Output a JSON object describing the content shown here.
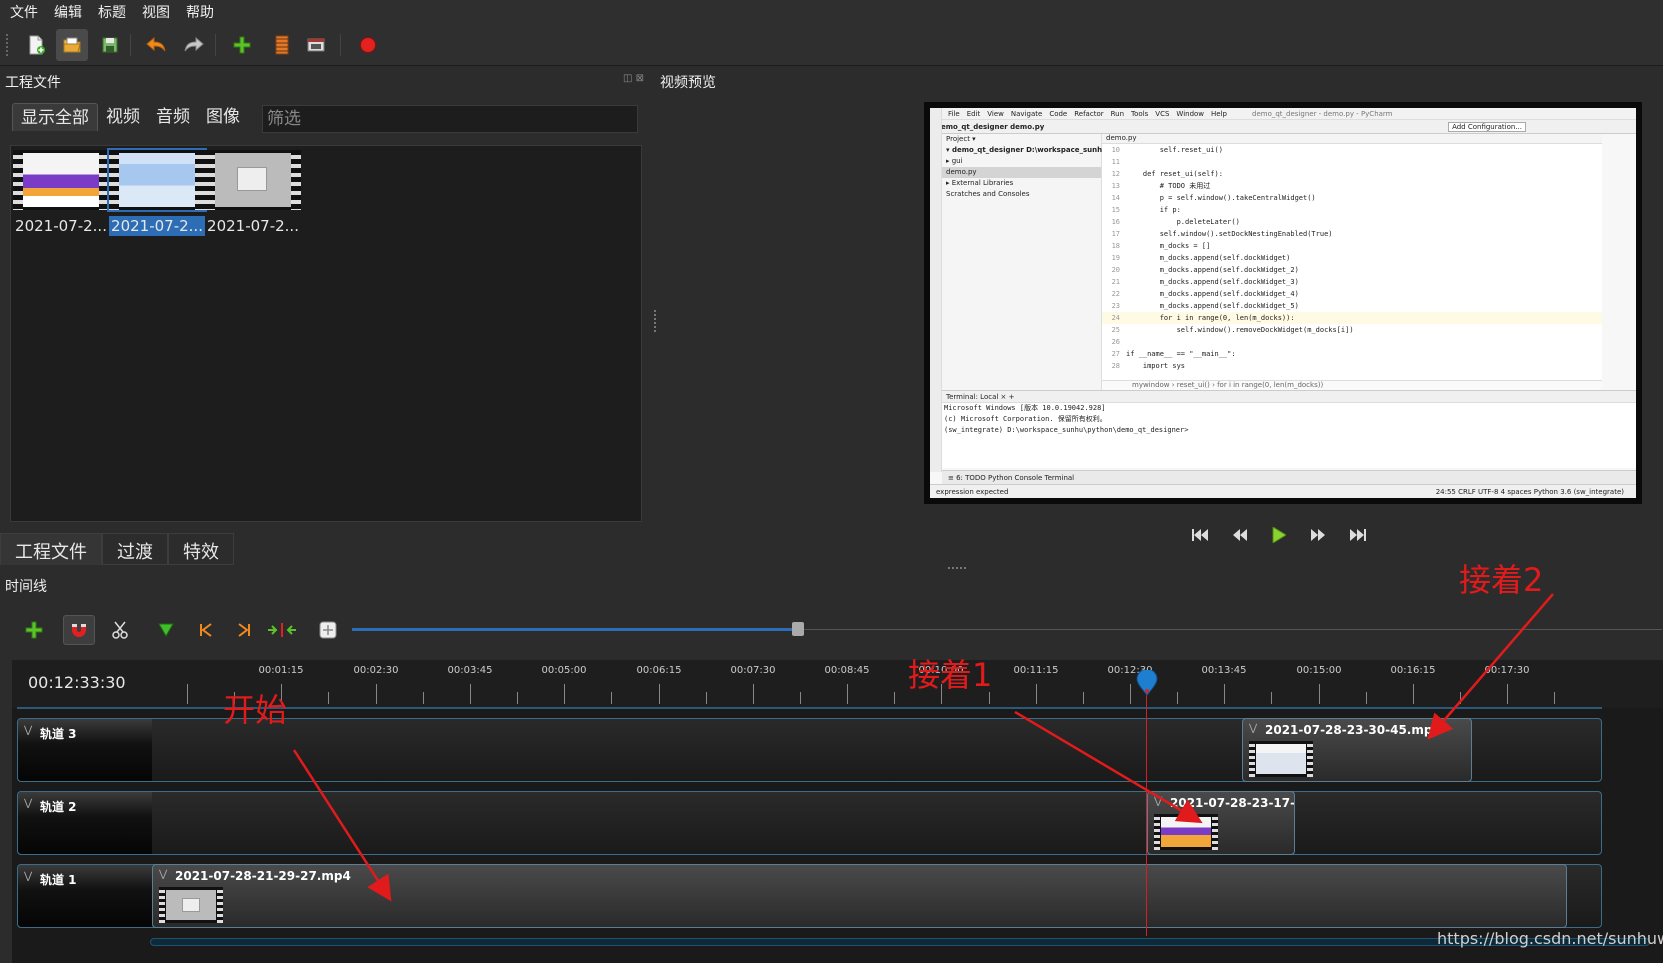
{
  "menubar": {
    "items": [
      "文件",
      "编辑",
      "标题",
      "视图",
      "帮助"
    ]
  },
  "toolbar": {
    "icons": [
      "new-project-icon",
      "open-project-icon",
      "save-project-icon",
      "undo-icon",
      "redo-icon",
      "import-files-icon",
      "profile-icon",
      "fullscreen-icon",
      "record-icon"
    ]
  },
  "project_files": {
    "title": "工程文件",
    "filters": [
      "显示全部",
      "视频",
      "音频",
      "图像"
    ],
    "filter_placeholder": "筛选",
    "files": [
      {
        "label": "2021-07-2..."
      },
      {
        "label": "2021-07-2..."
      },
      {
        "label": "2021-07-2..."
      }
    ],
    "bottom_tabs": [
      "工程文件",
      "过渡",
      "特效"
    ]
  },
  "preview": {
    "title": "视频预览",
    "ide": {
      "menu": [
        "File",
        "Edit",
        "View",
        "Navigate",
        "Code",
        "Refactor",
        "Run",
        "Tools",
        "VCS",
        "Window",
        "Help"
      ],
      "window_title": "demo_qt_designer - demo.py - PyCharm",
      "breadcrumb": "demo_qt_designer  demo.py",
      "run_config": "Add Configuration...",
      "project_tree": [
        "Project ▾",
        "▾ demo_qt_designer  D:\\workspace_sunhu",
        "  ▸ gui",
        "    demo.py",
        "▸ External Libraries",
        "  Scratches and Consoles"
      ],
      "code_tab": "demo.py",
      "code_lines": [
        {
          "n": "10",
          "t": "        self.reset_ui()"
        },
        {
          "n": "11",
          "t": ""
        },
        {
          "n": "12",
          "t": "    def reset_ui(self):"
        },
        {
          "n": "13",
          "t": "        # TODO 未用过"
        },
        {
          "n": "14",
          "t": "        p = self.window().takeCentralWidget()"
        },
        {
          "n": "15",
          "t": "        if p:"
        },
        {
          "n": "16",
          "t": "            p.deleteLater()"
        },
        {
          "n": "17",
          "t": "        self.window().setDockNestingEnabled(True)"
        },
        {
          "n": "18",
          "t": "        m_docks = []"
        },
        {
          "n": "19",
          "t": "        m_docks.append(self.dockWidget)"
        },
        {
          "n": "20",
          "t": "        m_docks.append(self.dockWidget_2)"
        },
        {
          "n": "21",
          "t": "        m_docks.append(self.dockWidget_3)"
        },
        {
          "n": "22",
          "t": "        m_docks.append(self.dockWidget_4)"
        },
        {
          "n": "23",
          "t": "        m_docks.append(self.dockWidget_5)"
        },
        {
          "n": "24",
          "t": "        for i in range(0, len(m_docks)):"
        },
        {
          "n": "25",
          "t": "            self.window().removeDockWidget(m_docks[i])"
        },
        {
          "n": "26",
          "t": ""
        },
        {
          "n": "27",
          "t": "if __name__ == \"__main__\":"
        },
        {
          "n": "28",
          "t": "    import sys"
        }
      ],
      "code_breadcrumb": "mywindow  ›  reset_ui()  ›  for i in range(0, len(m_docks))",
      "terminal_header": "Terminal:   Local  ×   +",
      "terminal_lines": [
        "Microsoft Windows [版本 10.0.19042.928]",
        "(c) Microsoft Corporation. 保留所有权利。",
        "(sw_integrate) D:\\workspace_sunhu\\python\\demo_qt_designer>"
      ],
      "bottom_tabs": "≡ 6: TODO    Python Console    Terminal",
      "status_left": "expression expected",
      "status_right": "24:55   CRLF   UTF-8   4 spaces   Python 3.6 (sw_integrate)"
    },
    "controls": [
      "jump-start-icon",
      "rewind-icon",
      "play-icon",
      "fast-forward-icon",
      "jump-end-icon"
    ]
  },
  "timeline": {
    "title": "时间线",
    "current_time": "00:12:33:30",
    "ticks": [
      "00:01:15",
      "00:02:30",
      "00:03:45",
      "00:05:00",
      "00:06:15",
      "00:07:30",
      "00:08:45",
      "00:10:00",
      "00:11:15",
      "00:12:30",
      "00:13:45",
      "00:15:00",
      "00:16:15",
      "00:17:30"
    ],
    "zoom_fraction": 0.34,
    "tracks": [
      {
        "name": "轨道 3",
        "clips": [
          {
            "name": "2021-07-28-23-30-45.mp4"
          }
        ]
      },
      {
        "name": "轨道 2",
        "clips": [
          {
            "name": "2021-07-28-23-17-..."
          }
        ]
      },
      {
        "name": "轨道 1",
        "clips": [
          {
            "name": "2021-07-28-21-29-27.mp4"
          }
        ]
      }
    ]
  },
  "annotations": {
    "start": "开始",
    "next1": "接着1",
    "next2": "接着2"
  },
  "watermark": "https://blog.csdn.net/sunhuwh",
  "colors": {
    "accent": "#2d6db5",
    "annotation": "#e11b1b",
    "playhead": "#d0202a",
    "track_border": "#3b6d8a"
  }
}
